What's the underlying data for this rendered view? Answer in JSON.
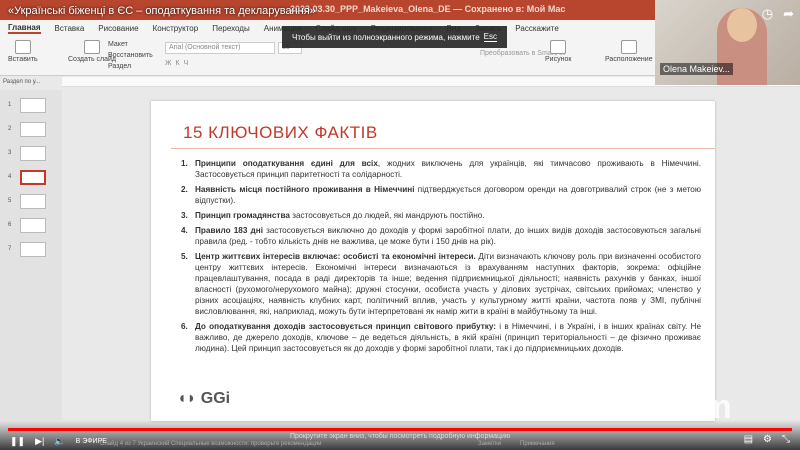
{
  "video": {
    "title": "«Українські біженці в ЄС – оподаткування та декларування»",
    "live_label": "В ЭФИРЕ",
    "scroll_hint": "Прокрутите экран вниз, чтобы посмотреть подробную информацию"
  },
  "app": {
    "document_title": "2023.03.30_PPP_Makeieva_Olena_DE — Сохранено в: Мой Mac",
    "menu": [
      "Главная",
      "Вставка",
      "Рисование",
      "Конструктор",
      "Переходы",
      "Анимация",
      "Слайд-шоу",
      "Рецензирование",
      "Вид",
      "Запись",
      "Расскажите"
    ],
    "ribbon": {
      "paste": "Вставить",
      "new_slide": "Создать слайд",
      "layout": "Макет",
      "reset": "Восстановить",
      "section": "Раздел",
      "font": "Arial (Основной текст)",
      "size": "15",
      "smartart": "Преобразовать в SmartArt",
      "picture": "Рисунок",
      "arrange": "Расположение"
    },
    "section_label": "Раздел по у...",
    "fullscreen_toast": {
      "text": "Чтобы выйти из полноэкранного режима, нажмите",
      "key": "Esc"
    },
    "status": {
      "left": "Слайд 4 из 7  Украинский  Специальные возможности: проверьте рекомендации",
      "notes": "Заметки",
      "comments": "Примечания"
    }
  },
  "thumbnails": [
    "1",
    "2",
    "3",
    "4",
    "5",
    "6",
    "7"
  ],
  "slide": {
    "title": "15 КЛЮЧОВИХ ФАКТІВ",
    "logo": "GGi",
    "facts": [
      {
        "n": "1.",
        "bold": "Принципи оподаткування єдині для всіх",
        "text": ", жодних виключень для українців, які тимчасово проживають в Німеччині. Застосовується принцип паритетності та солідарності."
      },
      {
        "n": "2.",
        "bold": "Наявність місця постійного проживання в Німеччині",
        "text": " підтверджується договором оренди на довготривалий строк (не з метою відпустки)."
      },
      {
        "n": "3.",
        "bold": "Принцип громадянства",
        "text": " застосовується до людей, які мандрують постійно."
      },
      {
        "n": "4.",
        "bold": "Правило 183 дні",
        "text": " застосовується виключно до доходів у формі заробітної плати, до інших видів доходів застосовуються загальні правила (ред. - тобто кількість днів не важлива, це може бути і 150 днів на рік)."
      },
      {
        "n": "5.",
        "bold": "Центр життєвих інтересів включає: особисті та економічні інтереси.",
        "text": " Діти визначають ключову роль при визначенні особистого центру життєвих інтересів. Економічні інтереси визначаються із врахуванням наступних факторів, зокрема: офіційне працевлаштування, посада в раді директорів та інше; ведення підприємницької діяльності; наявність рахунків у банках, іншої власності (рухомого/нерухомого майна); дружні стосунки, особиста участь у ділових зустрічах, світських прийомах; членство у різних асоціаціях, наявність клубних карт, політичний вплив, участь у культурному житті країни, частота появ у ЗМІ, публічні висловлювання, які, наприклад, можуть бути інтерпретовані як намір жити в країні в майбутньому та інші."
      },
      {
        "n": "6.",
        "bold": "До оподаткування доходів застосовується принцип світового прибутку:",
        "text": " і в Німеччині, і в Україні, і в інших країнах світу. Не важливо, де джерело доходів, ключове – де ведеться діяльність, в якій країні (принцип територіальності – де фізично проживає людина). Цей принцип застосовується як до доходів у формі заробітної плати, так і до підприємницьких доходів."
      }
    ]
  },
  "webcam": {
    "name": "Olena Makeiev..."
  },
  "watermark": "zoom",
  "colors": {
    "accent": "#b8462e",
    "title": "#c0392b",
    "progress": "#ff0000"
  }
}
